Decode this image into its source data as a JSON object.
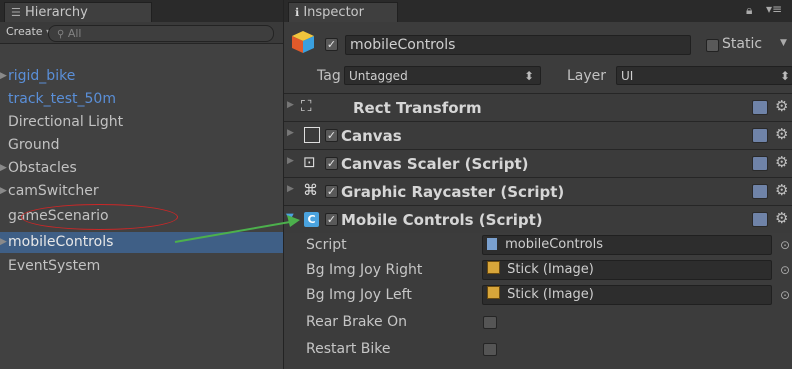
{
  "hierarchy": {
    "tab_title": "Hierarchy",
    "create_label": "Create",
    "search_placeholder": "All",
    "items": [
      {
        "label": "rigid_bike",
        "foldout": true
      },
      {
        "label": "track_test_50m",
        "foldout": false
      },
      {
        "label": "Directional Light",
        "foldout": false
      },
      {
        "label": "Ground",
        "foldout": false
      },
      {
        "label": "Obstacles",
        "foldout": true
      },
      {
        "label": "camSwitcher",
        "foldout": true
      },
      {
        "label": "gameScenario",
        "foldout": false
      },
      {
        "label": "mobileControls",
        "foldout": true
      },
      {
        "label": "EventSystem",
        "foldout": false
      }
    ]
  },
  "inspector": {
    "tab_title": "Inspector",
    "object_name": "mobileControls",
    "static_label": "Static",
    "tag_label": "Tag",
    "tag_value": "Untagged",
    "layer_label": "Layer",
    "layer_value": "UI",
    "components": [
      {
        "name": "Rect Transform",
        "has_checkbox": false
      },
      {
        "name": "Canvas",
        "has_checkbox": true
      },
      {
        "name": "Canvas Scaler (Script)",
        "has_checkbox": true
      },
      {
        "name": "Graphic Raycaster (Script)",
        "has_checkbox": true
      },
      {
        "name": "Mobile Controls (Script)",
        "has_checkbox": true
      }
    ],
    "properties": {
      "script_label": "Script",
      "script_value": "mobileControls",
      "bg_right_label": "Bg Img Joy Right",
      "bg_right_value": "Stick (Image)",
      "bg_left_label": "Bg Img Joy Left",
      "bg_left_value": "Stick (Image)",
      "rear_brake_label": "Rear Brake On",
      "restart_label": "Restart Bike"
    }
  },
  "colors": {
    "selection": "#3f5f86",
    "annotation_red": "#cc2727",
    "annotation_arrow": "#4cb04c",
    "prefab_blue": "#5a8fd8"
  }
}
